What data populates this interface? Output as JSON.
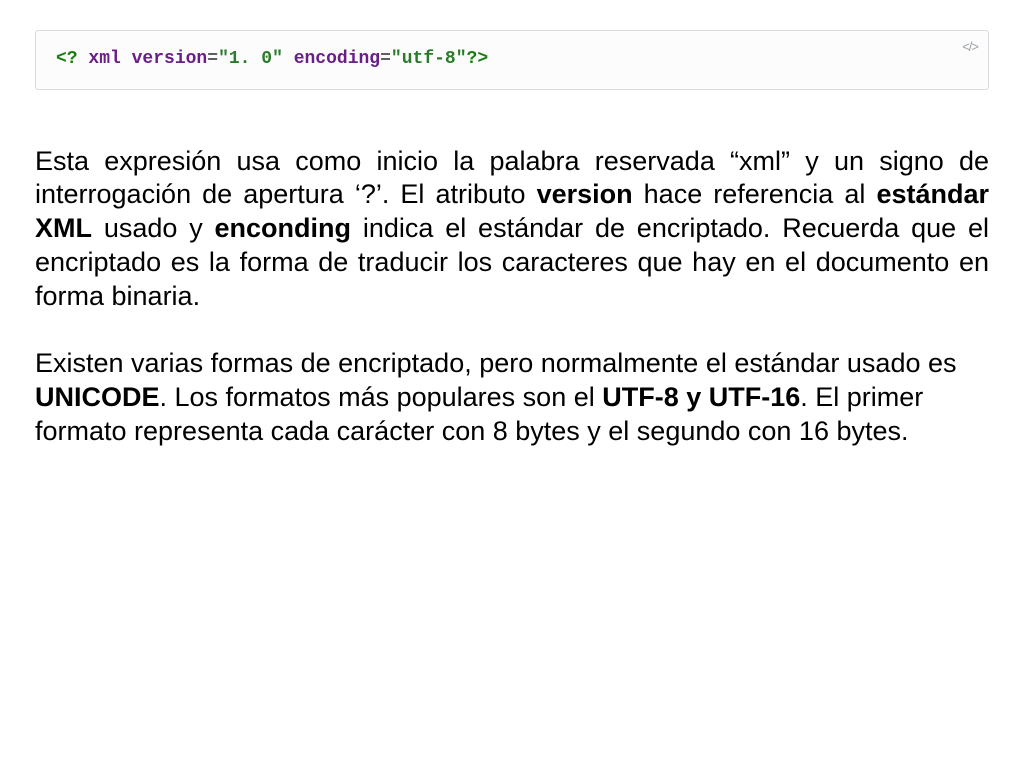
{
  "code": {
    "xml_open": "<? ",
    "xml_kw": "xml",
    "sp1": " ",
    "attr_version": "version",
    "eq": "=",
    "val_version": "\"1. 0\"",
    "sp2": " ",
    "attr_encoding": "encoding",
    "val_encoding": "\"utf-8\"",
    "xml_close": "?>",
    "icon_label": "</>"
  },
  "para1": {
    "t1": "Esta expresión usa como inicio la palabra reservada “xml” y un signo de interrogación de apertura ‘?’. El atributo ",
    "b1": "version",
    "t2": " hace referencia al ",
    "b2": "estándar XML",
    "t3": " usado y ",
    "b3": "enconding",
    "t4": " indica el estándar de encriptado. Recuerda que el encriptado es la forma de traducir los caracteres que hay en el documento en forma binaria."
  },
  "para2": {
    "t1": "Existen varias formas de encriptado, pero normalmente el estándar usado es ",
    "b1": "UNICODE",
    "t2": ". Los formatos más populares son el ",
    "b2": "UTF-8 y UTF-16",
    "t3": ". El primer formato representa cada carácter con 8 bytes y el segundo con 16 bytes."
  }
}
